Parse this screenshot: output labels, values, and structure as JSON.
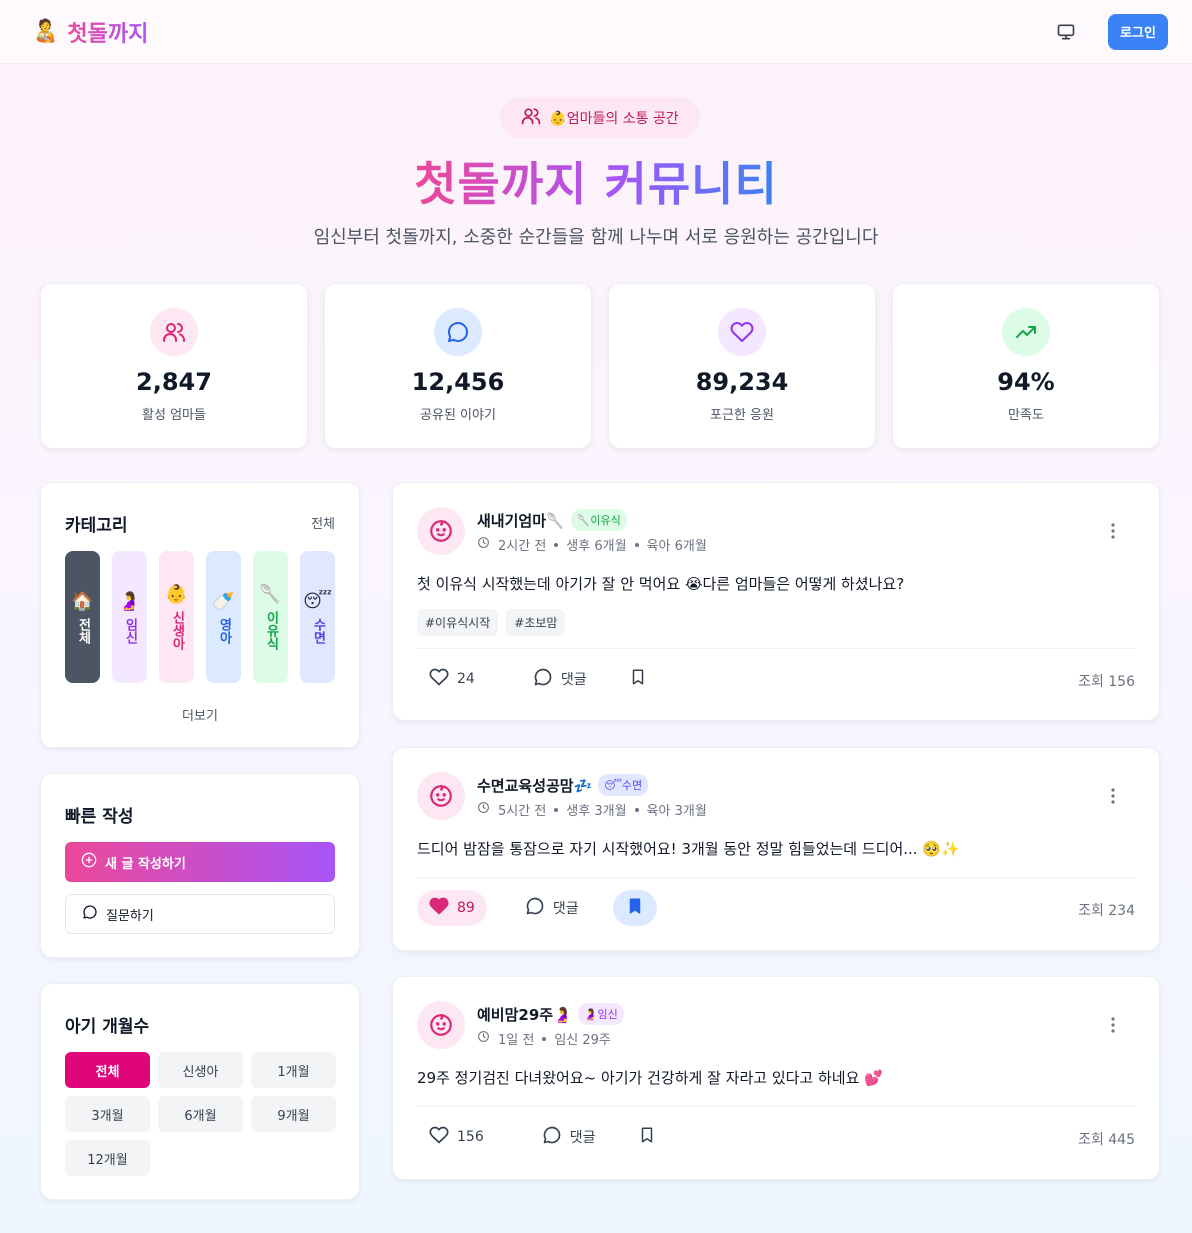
{
  "header": {
    "brand_emoji": "🧑‍🍼",
    "brand_name": "첫돌까지",
    "login_label": "로그인"
  },
  "hero": {
    "badge_text": "👶엄마들의 소통 공간",
    "title": "첫돌까지 커뮤니티",
    "subtitle": "임신부터 첫돌까지, 소중한 순간들을 함께 나누며 서로 응원하는 공간입니다"
  },
  "stats": [
    {
      "value": "2,847",
      "label": "활성 엄마들",
      "icon": "users-icon",
      "color": "#db2777",
      "bg": "#fce7f3"
    },
    {
      "value": "12,456",
      "label": "공유된 이야기",
      "icon": "chat-bubble-icon",
      "color": "#2563eb",
      "bg": "#dbeafe"
    },
    {
      "value": "89,234",
      "label": "포근한 응원",
      "icon": "heart-icon",
      "color": "#9333ea",
      "bg": "#f3e8ff"
    },
    {
      "value": "94%",
      "label": "만족도",
      "icon": "trending-up-icon",
      "color": "#16a34a",
      "bg": "#dcfce7"
    }
  ],
  "categories": {
    "title": "카테고리",
    "all_link": "전체",
    "more": "더보기",
    "items": [
      {
        "emoji": "🏠",
        "label": "전체",
        "bg": "#4b5563",
        "fg": "#ffffff"
      },
      {
        "emoji": "🤰",
        "label": "임신",
        "bg": "#f3e8ff",
        "fg": "#9333ea"
      },
      {
        "emoji": "👶",
        "label": "신생아",
        "bg": "#fce7f3",
        "fg": "#db2777"
      },
      {
        "emoji": "🍼",
        "label": "영아",
        "bg": "#dbeafe",
        "fg": "#2563eb"
      },
      {
        "emoji": "🥄",
        "label": "이유식",
        "bg": "#dcfce7",
        "fg": "#16a34a"
      },
      {
        "emoji": "😴",
        "label": "수면",
        "bg": "#e0e7ff",
        "fg": "#4f46e5"
      }
    ]
  },
  "quick_write": {
    "title": "빠른 작성",
    "new_post": "새 글 작성하기",
    "ask": "질문하기"
  },
  "baby_months": {
    "title": "아기 개월수",
    "options": [
      "전체",
      "신생아",
      "1개월",
      "3개월",
      "6개월",
      "9개월",
      "12개월"
    ],
    "selected": "전체"
  },
  "posts": [
    {
      "author": "새내기엄마🥄",
      "tag": "🥄이유식",
      "tag_bg": "#dcfce7",
      "tag_fg": "#16a34a",
      "time": "2시간 전",
      "meta": [
        "생후 6개월",
        "육아 6개월"
      ],
      "body": "첫 이유식 시작했는데 아기가 잘 안 먹어요 😭다른 엄마들은 어떻게 하셨나요?",
      "hashtags": [
        "#이유식시작",
        "#초보맘"
      ],
      "likes": "24",
      "liked": false,
      "comment_label": "댓글",
      "saved": false,
      "views": "조회 156"
    },
    {
      "author": "수면교육성공맘💤",
      "tag": "😴수면",
      "tag_bg": "#e0e7ff",
      "tag_fg": "#4f46e5",
      "time": "5시간 전",
      "meta": [
        "생후 3개월",
        "육아 3개월"
      ],
      "body": "드디어 밤잠을 통잠으로 자기 시작했어요! 3개월 동안 정말 힘들었는데 드디어... 🥺✨",
      "hashtags": [],
      "likes": "89",
      "liked": true,
      "comment_label": "댓글",
      "saved": true,
      "views": "조회 234"
    },
    {
      "author": "예비맘29주🤰",
      "tag": "🤰임신",
      "tag_bg": "#f3e8ff",
      "tag_fg": "#9333ea",
      "time": "1일 전",
      "meta": [
        "임신 29주"
      ],
      "body": "29주 정기검진 다녀왔어요~ 아기가 건강하게 잘 자라고 있다고 하네요 💕",
      "hashtags": [],
      "likes": "156",
      "liked": false,
      "comment_label": "댓글",
      "saved": false,
      "views": "조회 445"
    }
  ]
}
